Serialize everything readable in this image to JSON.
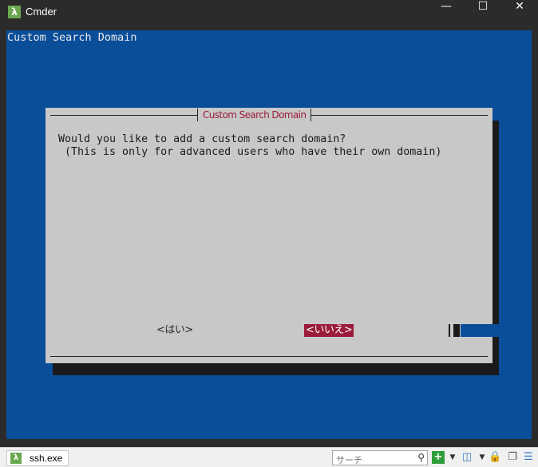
{
  "window": {
    "title": "Cmder",
    "app_icon": "λ",
    "controls": {
      "minimize": "—",
      "maximize": "☐",
      "close": "✕"
    }
  },
  "terminal": {
    "header": "Custom Search Domain"
  },
  "dialog": {
    "title": "Custom Search Domain",
    "message": "Would you like to add a custom search domain?\n (This is only for advanced users who have their own domain)",
    "buttons": {
      "yes": "<はい>",
      "no": "<いいえ>"
    },
    "selected_button": "no"
  },
  "statusbar": {
    "tab_icon": "λ",
    "tab_label": "ssh.exe",
    "search_placeholder": "サーチ",
    "icons": [
      "search-icon",
      "add-console-icon",
      "dropdown-icon",
      "layout-icon",
      "lock-icon",
      "window-icon",
      "menu-icon"
    ]
  },
  "colors": {
    "terminal_bg": "#0a4e9a",
    "dialog_bg": "#c8c8c8",
    "accent": "#9b1c3a",
    "app_icon": "#6aa84f"
  }
}
